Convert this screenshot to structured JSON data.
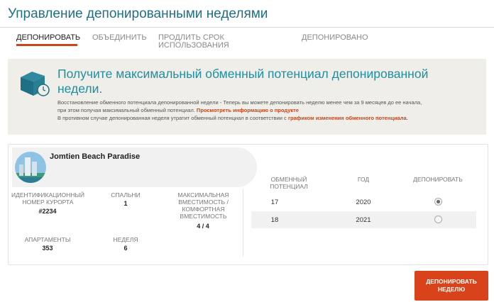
{
  "page": {
    "title": "Управление депонированными неделями"
  },
  "tabs": [
    {
      "label": "ДЕПОНИРОВАТЬ",
      "active": true
    },
    {
      "label": "ОБЪЕДИНИТЬ",
      "active": false
    },
    {
      "label": "ПРОДЛИТЬ СРОК",
      "label2": "ИСПОЛЬЗОВАНИЯ",
      "active": false
    },
    {
      "label": "ДЕПОНИРОВАНО",
      "active": false
    }
  ],
  "banner": {
    "icon": "box-clock-icon",
    "headline": "Получите максимальный обменный потенциал депонированной недели.",
    "line1": "Восстановление обменного потенциала депонированной недели - Теперь вы можете депонировать неделю менее чем за 9 месяцев до ее начала,",
    "line2_text": "при этом получая максимальный обменный потенциал.",
    "line2_link": "Просмотреть информацию о продукте",
    "line3_text": "В противном случае депонированная неделя утратит обменный потенциал в соответствии с",
    "line3_link": "графиком изменения обменного потенциала."
  },
  "resort": {
    "name": "Jomtien Beach Paradise",
    "details": {
      "resort_id_label": "ИДЕНТИФИКАЦИОННЫЙ НОМЕР КУРОРТА",
      "resort_id_value": "#2234",
      "bedrooms_label": "СПАЛЬНИ",
      "bedrooms_value": "1",
      "capacity_label": "МАКСИМАЛЬНАЯ ВМЕСТИМОСТЬ / КОМФОРТНАЯ ВМЕСТИМОСТЬ",
      "capacity_value": "4 / 4",
      "unit_label": "АПАРТАМЕНТЫ",
      "unit_value": "353",
      "week_label": "НЕДЕЛЯ",
      "week_value": "6"
    }
  },
  "table": {
    "headers": [
      "ОБМЕННЫЙ ПОТЕНЦИАЛ",
      "ГОД",
      "ДЕПОНИРОВАТЬ"
    ],
    "rows": [
      {
        "potential": "17",
        "year": "2020",
        "selected": true
      },
      {
        "potential": "18",
        "year": "2021",
        "selected": false
      }
    ]
  },
  "actions": {
    "deposit_button": "ДЕПОНИРОВАТЬ НЕДЕЛЮ"
  },
  "colors": {
    "accent": "#c9461d",
    "button": "#d8431b",
    "headline": "#1f8ea3",
    "title": "#1f6f86"
  }
}
